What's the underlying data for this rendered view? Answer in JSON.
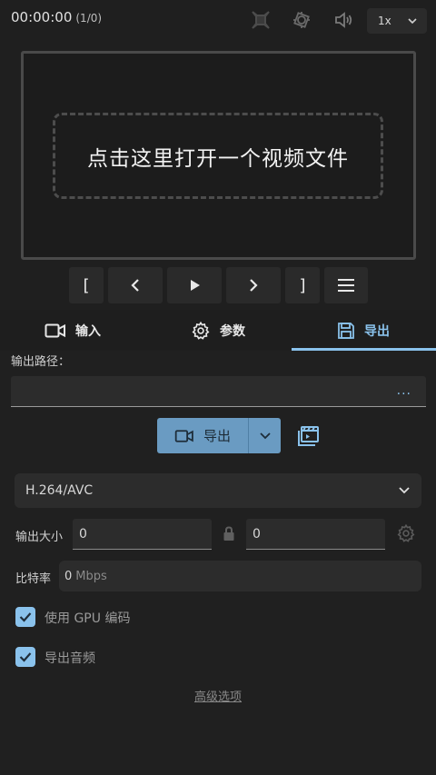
{
  "header": {
    "time": "00:00:00",
    "frames": "(1/0)",
    "speed": {
      "selected": "1x"
    },
    "icons": [
      "crop-icon",
      "stabilize-icon",
      "volume-icon"
    ]
  },
  "player": {
    "open_prompt": "点击这里打开一个视频文件",
    "controls": {
      "mark_in": "[",
      "mark_out": "]"
    }
  },
  "tabs": [
    {
      "label": "输入",
      "icon": "video-camera-icon"
    },
    {
      "label": "参数",
      "icon": "gear-icon"
    },
    {
      "label": "导出",
      "icon": "save-icon",
      "active": true
    }
  ],
  "export_panel": {
    "output_path_label": "输出路径：",
    "output_path_value": "",
    "more_button": "...",
    "export_button": "导出",
    "codec": {
      "selected": "H.264/AVC"
    },
    "size": {
      "label": "输出大小",
      "width": "0",
      "height": "0"
    },
    "bitrate": {
      "label": "比特率",
      "value": "0",
      "unit": "Mbps"
    },
    "use_gpu": {
      "label": "使用 GPU 编码",
      "checked": true
    },
    "export_audio": {
      "label": "导出音频",
      "checked": true
    },
    "advanced_link": "高级选项"
  },
  "colors": {
    "accent": "#8ac2ec",
    "export_button": "#6a9bc2",
    "background": "#1f1f1f",
    "field": "#2c2c2c"
  }
}
